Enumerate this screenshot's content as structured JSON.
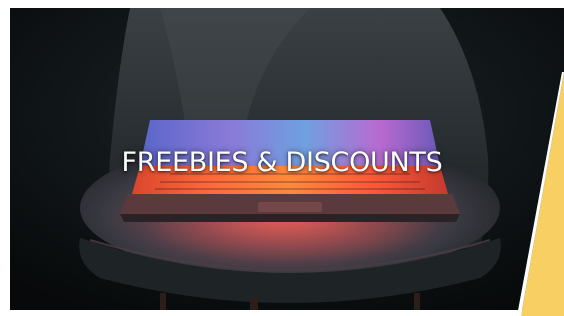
{
  "banner": {
    "headline": "FREEBIES & DISCOUNTS",
    "image": "laptop-on-chair-photo"
  },
  "colors": {
    "background": "#0b0e10",
    "accent_yellow": "#f7cf63",
    "text": "#ffffff"
  }
}
